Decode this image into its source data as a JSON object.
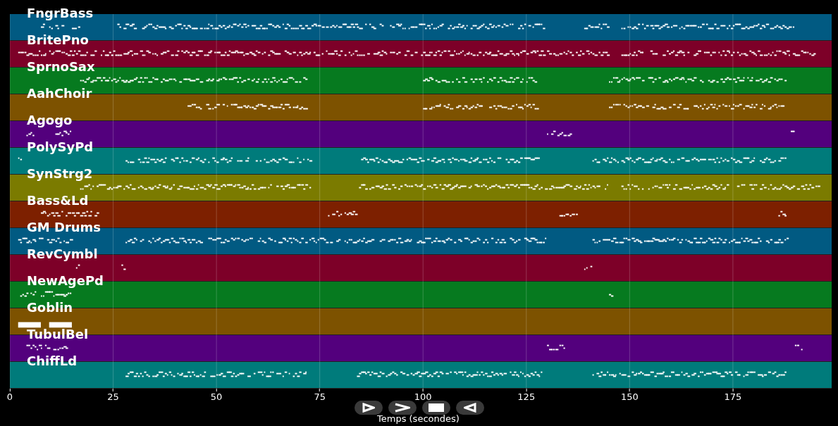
{
  "tracks": [
    {
      "name": "FngrBass",
      "color": "#015a82"
    },
    {
      "name": "BritePno",
      "color": "#7d0028"
    },
    {
      "name": "SprnoSax",
      "color": "#067a1f"
    },
    {
      "name": "AahChoir",
      "color": "#7d5200"
    },
    {
      "name": "Agogo",
      "color": "#53007d"
    },
    {
      "name": "PolySyPd",
      "color": "#007b7b"
    },
    {
      "name": "SynStrg2",
      "color": "#7b7b00"
    },
    {
      "name": "Bass&Ld",
      "color": "#7d2000"
    },
    {
      "name": "GM Drums",
      "color": "#015a82"
    },
    {
      "name": "RevCymbl",
      "color": "#7d0028"
    },
    {
      "name": "NewAgePd",
      "color": "#067a1f"
    },
    {
      "name": "Goblin",
      "color": "#7d5200"
    },
    {
      "name": "TubulBel",
      "color": "#53007d"
    },
    {
      "name": "ChiffLd",
      "color": "#007b7b"
    }
  ],
  "x_axis": {
    "ticks": [
      "0",
      "25",
      "50",
      "75",
      "100",
      "125",
      "150",
      "175"
    ],
    "label": "Temps (secondes)"
  },
  "controls": [
    {
      "kind": "play"
    },
    {
      "kind": "forward"
    },
    {
      "kind": "stop"
    },
    {
      "kind": "back"
    }
  ]
}
